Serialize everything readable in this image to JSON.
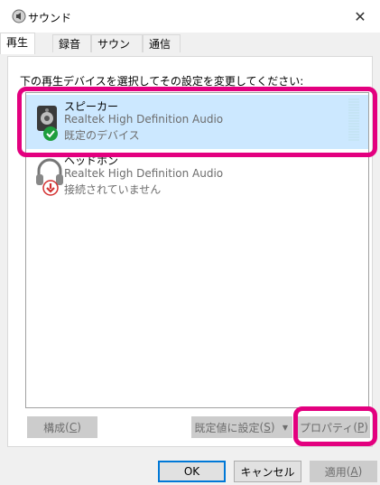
{
  "window": {
    "title": "サウンド",
    "close_glyph": "✕"
  },
  "tabs": [
    {
      "label": "再生",
      "active": true
    },
    {
      "label": "録音",
      "active": false
    },
    {
      "label": "サウンド",
      "active": false
    },
    {
      "label": "通信",
      "active": false
    }
  ],
  "instruction": "下の再生デバイスを選択してその設定を変更してください:",
  "devices": [
    {
      "name": "スピーカー",
      "driver": "Realtek High Definition Audio",
      "status": "既定のデバイス",
      "icon": "speaker-icon",
      "status_icon": "green-check-icon",
      "selected": true
    },
    {
      "name": "ヘッドホン",
      "driver": "Realtek High Definition Audio",
      "status": "接続されていません",
      "icon": "headphones-icon",
      "status_icon": "red-down-arrow-icon",
      "selected": false
    }
  ],
  "buttons": {
    "configure": {
      "label": "構成",
      "accel": "C"
    },
    "set_default": {
      "label": "既定値に設定",
      "accel": "S"
    },
    "properties": {
      "label": "プロパティ",
      "accel": "P"
    },
    "ok": {
      "label": "OK"
    },
    "cancel": {
      "label": "キャンセル"
    },
    "apply": {
      "label": "適用",
      "accel": "A"
    }
  },
  "colors": {
    "highlight": "#e3007f",
    "selection": "#cce8ff",
    "check": "#1e9e3e",
    "warn": "#d32f2f"
  }
}
